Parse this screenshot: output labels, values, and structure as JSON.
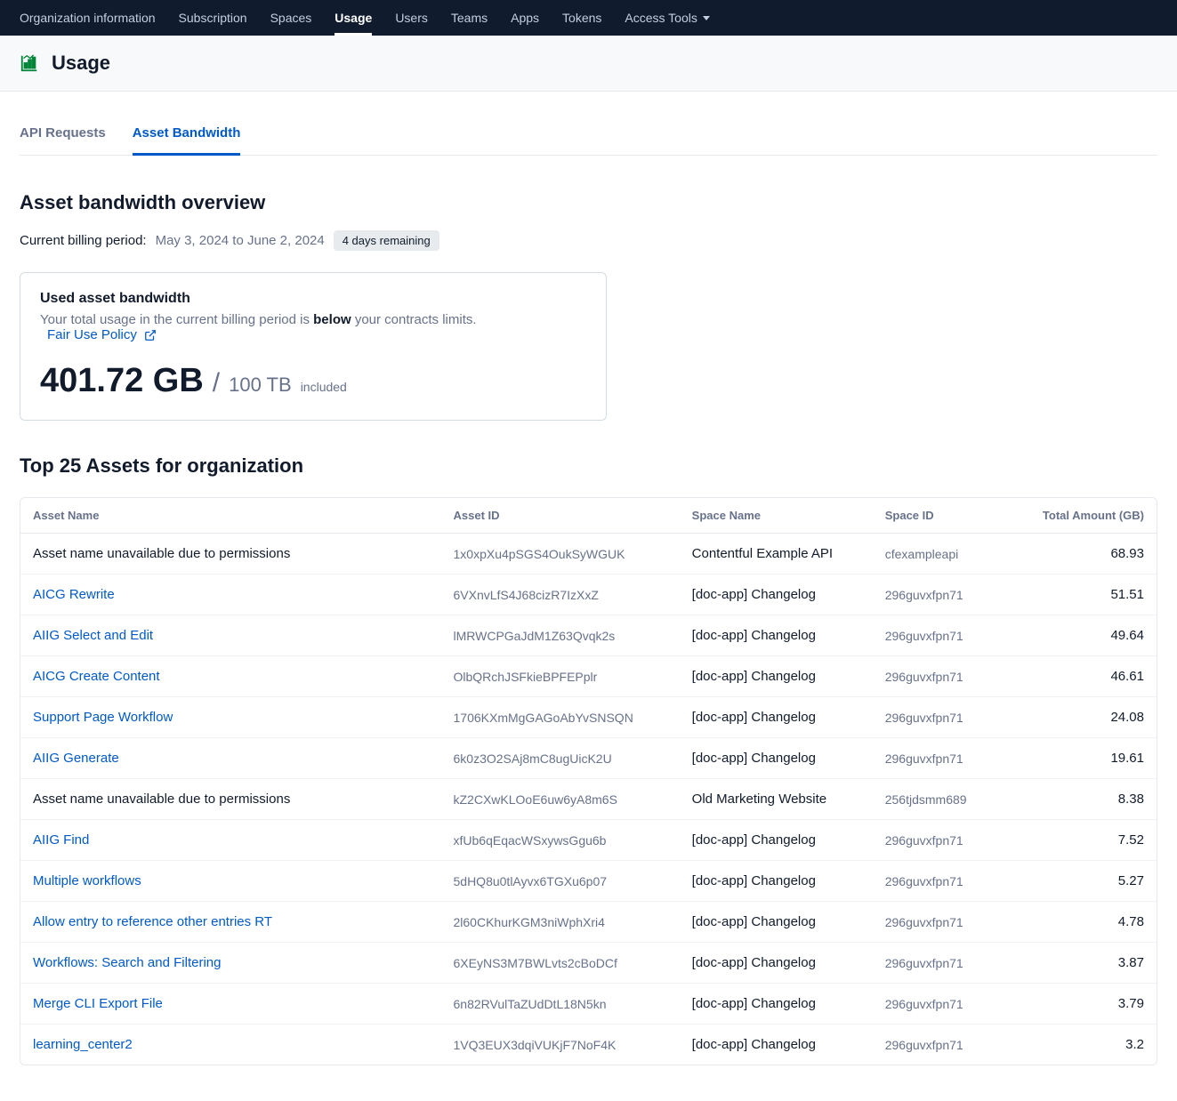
{
  "topnav": {
    "items": [
      {
        "label": "Organization information"
      },
      {
        "label": "Subscription"
      },
      {
        "label": "Spaces"
      },
      {
        "label": "Usage",
        "active": true
      },
      {
        "label": "Users"
      },
      {
        "label": "Teams"
      },
      {
        "label": "Apps"
      },
      {
        "label": "Tokens"
      },
      {
        "label": "Access Tools",
        "dropdown": true
      }
    ]
  },
  "page": {
    "title": "Usage"
  },
  "subtabs": {
    "items": [
      {
        "label": "API Requests"
      },
      {
        "label": "Asset Bandwidth",
        "active": true
      }
    ]
  },
  "overview": {
    "title": "Asset bandwidth overview",
    "billing_label": "Current billing period:",
    "billing_range": "May 3, 2024 to June 2, 2024",
    "badge": "4 days remaining"
  },
  "card": {
    "title": "Used asset bandwidth",
    "desc_pre": "Your total usage in the current billing period is ",
    "desc_bold": "below",
    "desc_post": " your contracts limits.",
    "link": "Fair Use Policy",
    "used": "401.72 GB",
    "limit": "100 TB",
    "included": "included"
  },
  "topassets": {
    "title": "Top 25 Assets for organization",
    "columns": {
      "asset_name": "Asset Name",
      "asset_id": "Asset ID",
      "space_name": "Space Name",
      "space_id": "Space ID",
      "total": "Total Amount (GB)"
    },
    "rows": [
      {
        "name": "Asset name unavailable due to permissions",
        "unavail": true,
        "id": "1x0xpXu4pSGS4OukSyWGUK",
        "space_name": "Contentful Example API",
        "space_id": "cfexampleapi",
        "total": "68.93"
      },
      {
        "name": "AICG Rewrite",
        "id": "6VXnvLfS4J68cizR7IzXxZ",
        "space_name": "[doc-app] Changelog",
        "space_id": "296guvxfpn71",
        "total": "51.51"
      },
      {
        "name": "AIIG Select and Edit",
        "id": "lMRWCPGaJdM1Z63Qvqk2s",
        "space_name": "[doc-app] Changelog",
        "space_id": "296guvxfpn71",
        "total": "49.64"
      },
      {
        "name": "AICG Create Content",
        "id": "OlbQRchJSFkieBPFEPplr",
        "space_name": "[doc-app] Changelog",
        "space_id": "296guvxfpn71",
        "total": "46.61"
      },
      {
        "name": "Support Page Workflow",
        "id": "1706KXmMgGAGoAbYvSNSQN",
        "space_name": "[doc-app] Changelog",
        "space_id": "296guvxfpn71",
        "total": "24.08"
      },
      {
        "name": "AIIG Generate",
        "id": "6k0z3O2SAj8mC8ugUicK2U",
        "space_name": "[doc-app] Changelog",
        "space_id": "296guvxfpn71",
        "total": "19.61"
      },
      {
        "name": "Asset name unavailable due to permissions",
        "unavail": true,
        "id": "kZ2CXwKLOoE6uw6yA8m6S",
        "space_name": "Old Marketing Website",
        "space_id": "256tjdsmm689",
        "total": "8.38"
      },
      {
        "name": "AIIG Find",
        "id": "xfUb6qEqacWSxywsGgu6b",
        "space_name": "[doc-app] Changelog",
        "space_id": "296guvxfpn71",
        "total": "7.52"
      },
      {
        "name": "Multiple workflows",
        "id": "5dHQ8u0tlAyvx6TGXu6p07",
        "space_name": "[doc-app] Changelog",
        "space_id": "296guvxfpn71",
        "total": "5.27"
      },
      {
        "name": "Allow entry to reference other entries RT",
        "id": "2l60CKhurKGM3niWphXri4",
        "space_name": "[doc-app] Changelog",
        "space_id": "296guvxfpn71",
        "total": "4.78"
      },
      {
        "name": "Workflows: Search and Filtering",
        "id": "6XEyNS3M7BWLvts2cBoDCf",
        "space_name": "[doc-app] Changelog",
        "space_id": "296guvxfpn71",
        "total": "3.87"
      },
      {
        "name": "Merge CLI Export File",
        "id": "6n82RVulTaZUdDtL18N5kn",
        "space_name": "[doc-app] Changelog",
        "space_id": "296guvxfpn71",
        "total": "3.79"
      },
      {
        "name": "learning_center2",
        "id": "1VQ3EUX3dqiVUKjF7NoF4K",
        "space_name": "[doc-app] Changelog",
        "space_id": "296guvxfpn71",
        "total": "3.2"
      }
    ]
  }
}
